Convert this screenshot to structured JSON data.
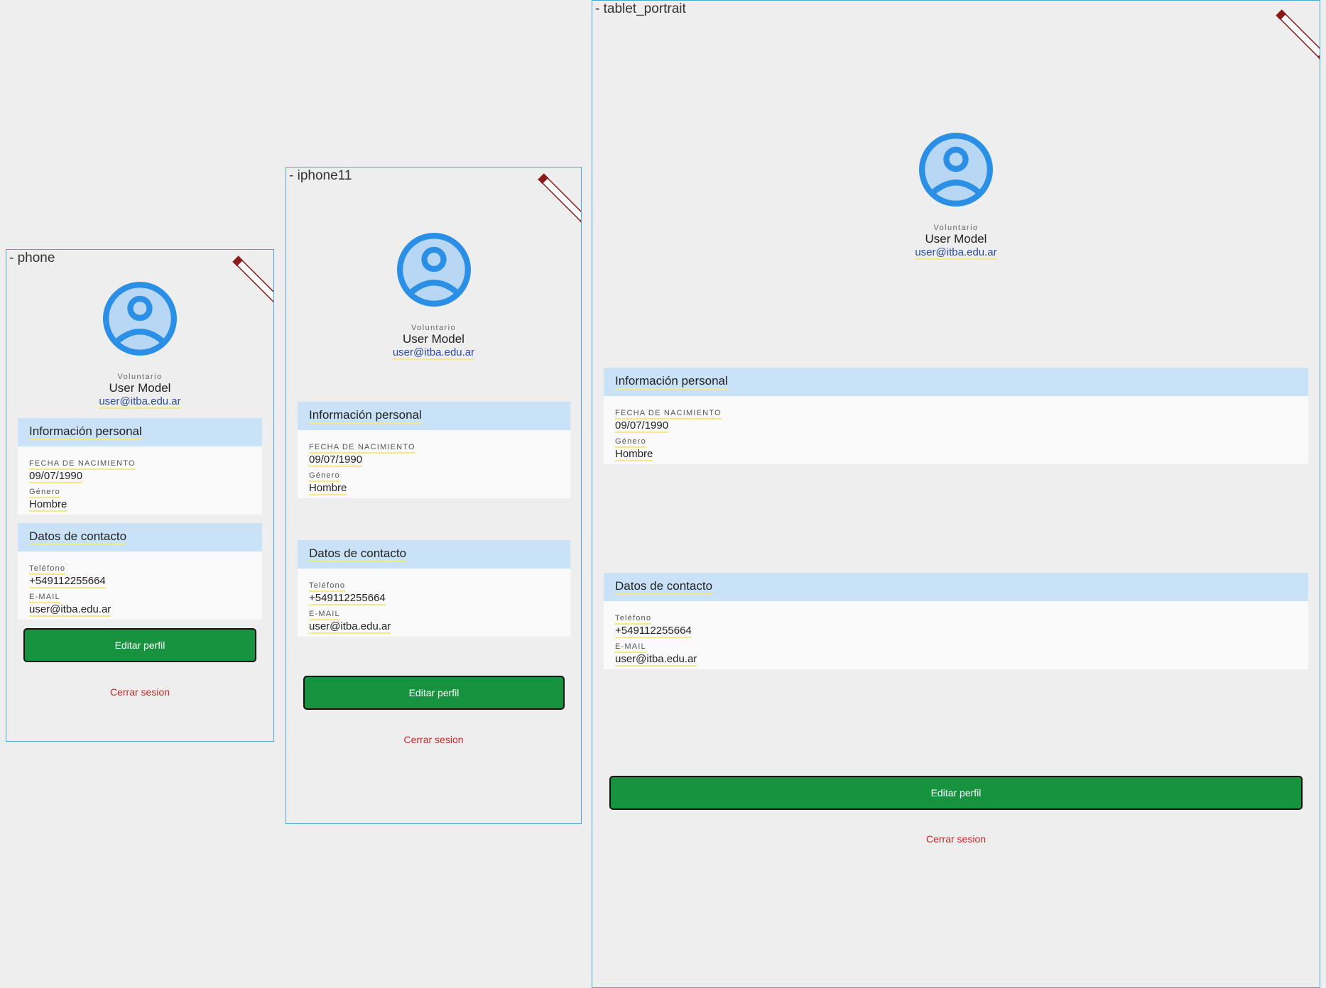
{
  "colors": {
    "frame_border": "#4aa8d8",
    "section_header": "#c9e2f7",
    "button": "#179340",
    "logout": "#c62828",
    "email_link": "#2a4a9c",
    "debug_banner": "#8b1a1a"
  },
  "devices": [
    {
      "id": "phone",
      "label": "- phone"
    },
    {
      "id": "iphone11",
      "label": "- iphone11"
    },
    {
      "id": "tablet_portrait",
      "label": "- tablet_portrait"
    }
  ],
  "profile": {
    "avatar_icon": "account-circle-icon",
    "role": "Voluntario",
    "name": "User Model",
    "email": "user@itba.edu.ar"
  },
  "personal": {
    "title": "Información personal",
    "birth_label": "FECHA DE NACIMIENTO",
    "birth_value": "09/07/1990",
    "gender_label": "Género",
    "gender_value": "Hombre"
  },
  "contact": {
    "title": "Datos de contacto",
    "phone_label": "Teléfono",
    "phone_value": "+549112255664",
    "email_label": "E-MAIL",
    "email_value": "user@itba.edu.ar"
  },
  "actions": {
    "edit_label": "Editar perfil",
    "logout_label": "Cerrar sesion"
  }
}
